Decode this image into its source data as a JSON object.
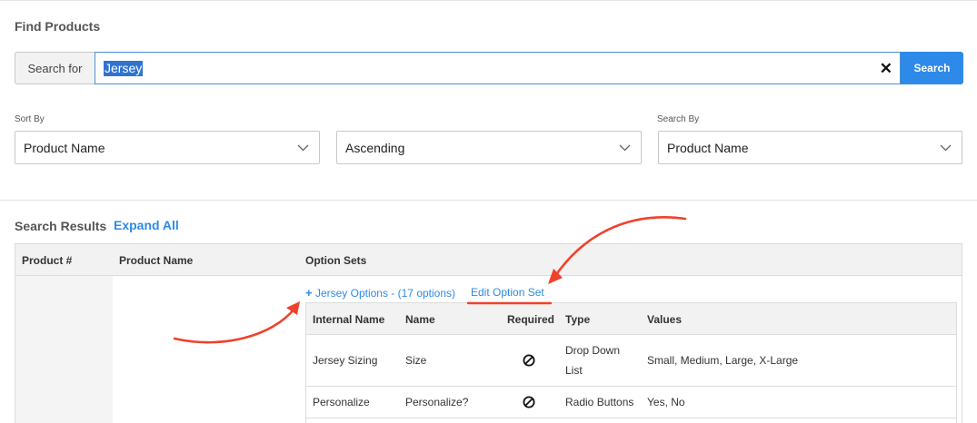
{
  "find": {
    "title": "Find Products",
    "search_for_label": "Search for",
    "query_value": "Jersey",
    "search_button": "Search"
  },
  "filters": {
    "sort_by_label": "Sort By",
    "sort_by_value": "Product Name",
    "order_value": "Ascending",
    "search_by_label": "Search By",
    "search_by_value": "Product Name"
  },
  "results": {
    "title": "Search Results",
    "expand_all": "Expand All",
    "columns": [
      "Product #",
      "Product Name",
      "Option Sets"
    ],
    "option_set_link": "Jersey Options - (17 options)",
    "edit_option_set": "Edit Option Set",
    "option_columns": [
      "Internal Name",
      "Name",
      "Required",
      "Type",
      "Values"
    ],
    "option_rows": [
      {
        "internal_name": "Jersey Sizing",
        "name": "Size",
        "required_icon": "not-required-icon",
        "type_line1": "Drop Down",
        "type_line2": "List",
        "values": "Small, Medium, Large, X-Large"
      },
      {
        "internal_name": "Personalize",
        "name": "Personalize?",
        "required_icon": "not-required-icon",
        "type": "Radio Buttons",
        "values": "Yes, No"
      }
    ]
  },
  "colors": {
    "accent": "#2d8ae8",
    "selection": "#2f73d0",
    "annotation": "#f0412a"
  }
}
